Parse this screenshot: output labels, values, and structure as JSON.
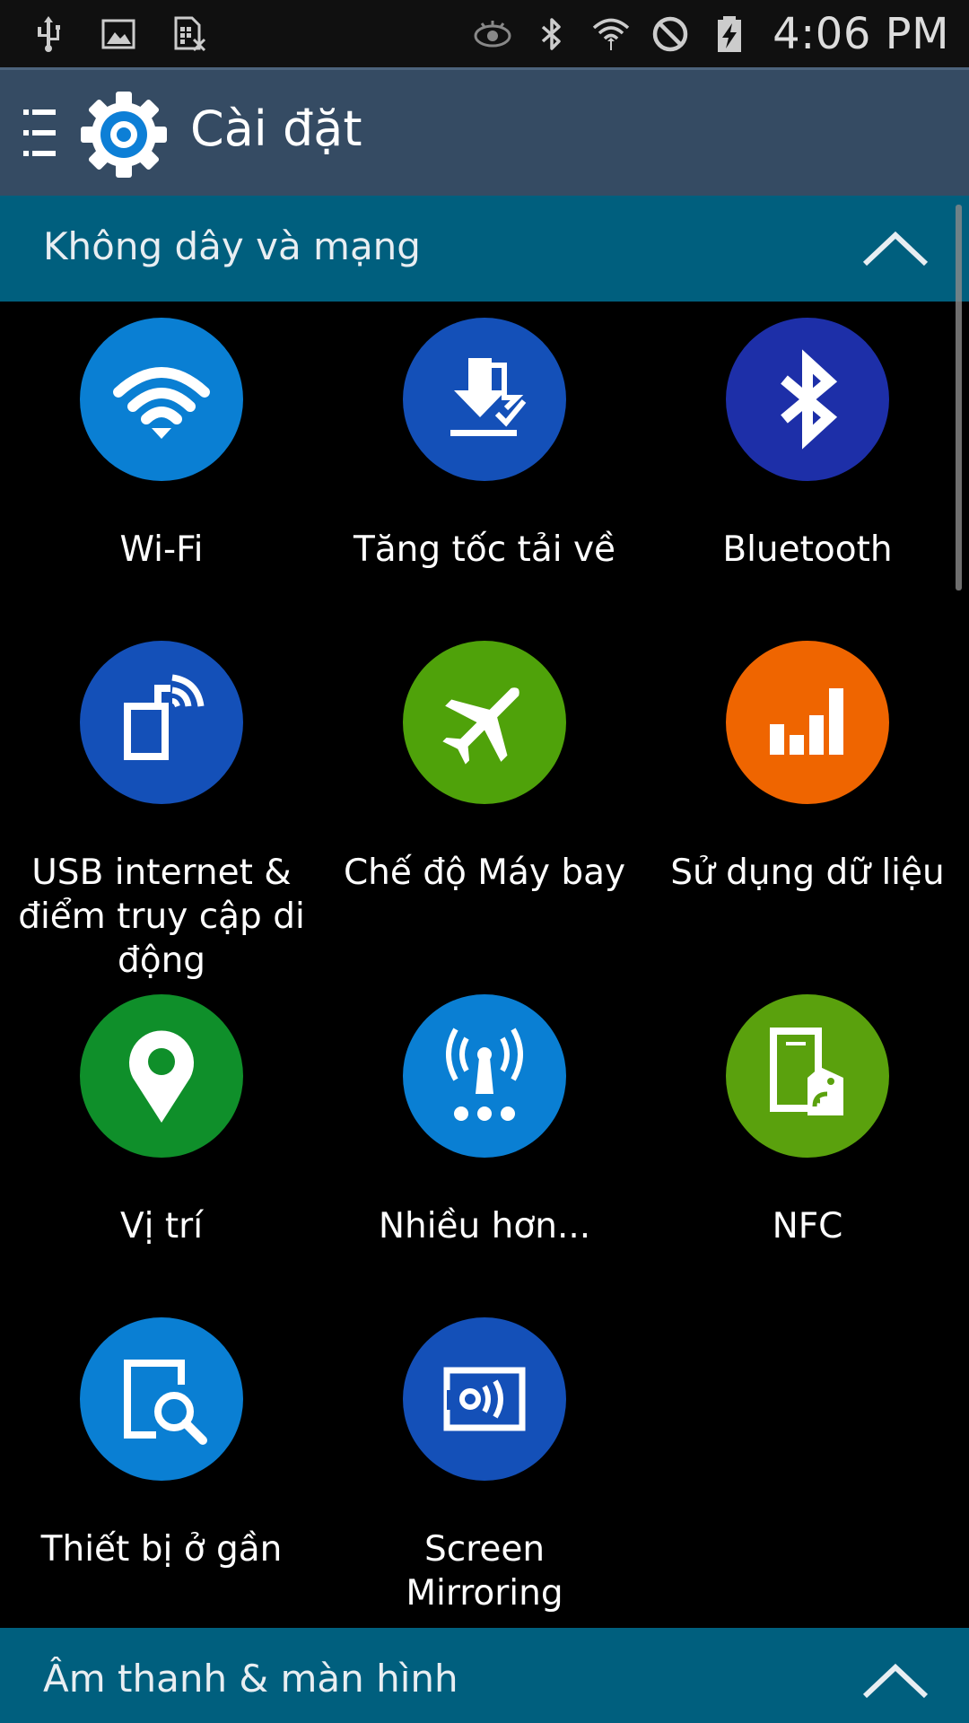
{
  "status_bar": {
    "time": "4:06 PM",
    "left_icons": [
      "usb-icon",
      "image-icon",
      "sim-missing-icon"
    ],
    "right_icons": [
      "eye-icon",
      "bluetooth-icon",
      "wifi-icon",
      "block-icon",
      "battery-charging-icon"
    ]
  },
  "action_bar": {
    "title": "Cài đặt",
    "icons": [
      "menu-icon",
      "settings-gear-icon"
    ]
  },
  "sections": [
    {
      "label": "Không dây và mạng",
      "icon": "chevron-up-icon"
    },
    {
      "label": "Âm thanh & màn hình",
      "icon": "chevron-up-icon"
    }
  ],
  "tiles": [
    {
      "label": "Wi-Fi",
      "icon": "wifi-icon",
      "color": "#0a7fd3"
    },
    {
      "label": "Tăng tốc tải về",
      "icon": "download-booster-icon",
      "color": "#1450b8"
    },
    {
      "label": "Bluetooth",
      "icon": "bluetooth-icon",
      "color": "#1d2fa8"
    },
    {
      "label": "USB internet & điểm truy cập di động",
      "icon": "hotspot-icon",
      "color": "#1450b8"
    },
    {
      "label": "Chế độ Máy bay",
      "icon": "airplane-icon",
      "color": "#4fa20a"
    },
    {
      "label": "Sử dụng dữ liệu",
      "icon": "data-usage-icon",
      "color": "#ef6500"
    },
    {
      "label": "Vị trí",
      "icon": "location-pin-icon",
      "color": "#0f8f2a"
    },
    {
      "label": "Nhiều hơn...",
      "icon": "more-networks-icon",
      "color": "#0a7fd3"
    },
    {
      "label": "NFC",
      "icon": "nfc-icon",
      "color": "#5aa10d"
    },
    {
      "label": "Thiết bị ở gần",
      "icon": "nearby-devices-icon",
      "color": "#0a7fd3"
    },
    {
      "label": "Screen Mirroring",
      "icon": "screen-mirroring-icon",
      "color": "#1450b8"
    }
  ]
}
